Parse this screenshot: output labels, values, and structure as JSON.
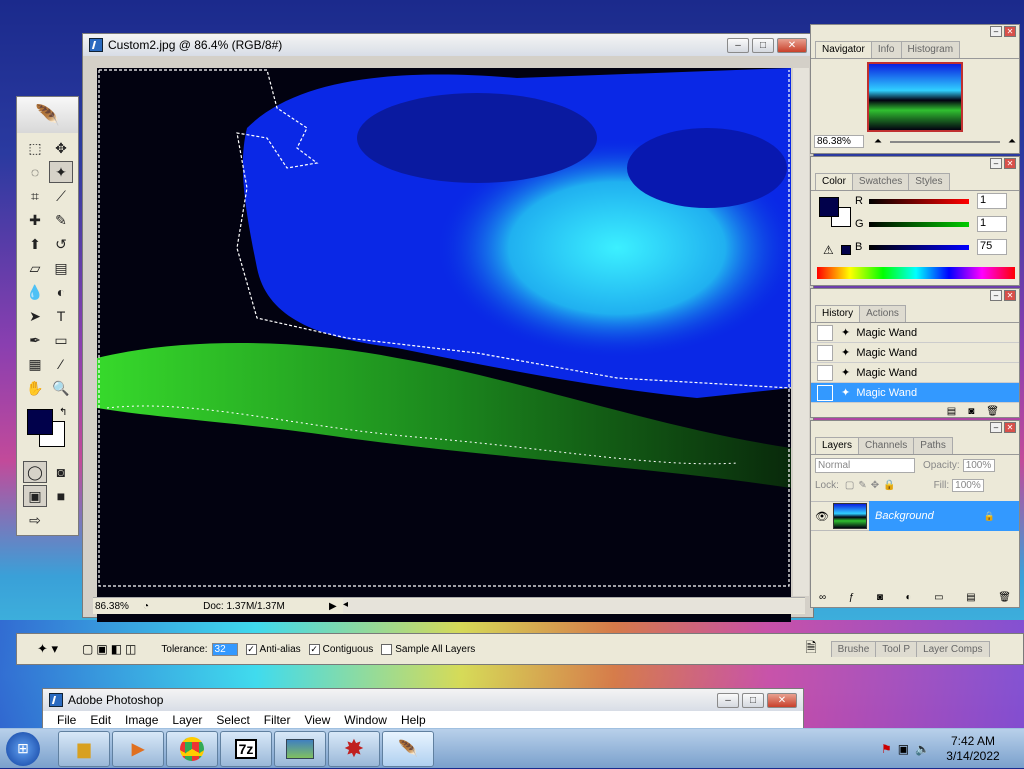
{
  "document": {
    "title": "Custom2.jpg @ 86.4% (RGB/8#)",
    "zoom": "86.38%",
    "doc_size": "Doc: 1.37M/1.37M"
  },
  "navigator": {
    "tabs": [
      "Navigator",
      "Info",
      "Histogram"
    ],
    "zoom": "86.38%"
  },
  "color": {
    "tabs": [
      "Color",
      "Swatches",
      "Styles"
    ],
    "r_label": "R",
    "g_label": "G",
    "b_label": "B",
    "r": "1",
    "g": "1",
    "b": "75",
    "foreground_hex": "#01014b"
  },
  "history": {
    "tabs": [
      "History",
      "Actions"
    ],
    "items": [
      "Magic Wand",
      "Magic Wand",
      "Magic Wand",
      "Magic Wand"
    ]
  },
  "layers": {
    "tabs": [
      "Layers",
      "Channels",
      "Paths"
    ],
    "blend_mode": "Normal",
    "opacity_label": "Opacity:",
    "opacity": "100%",
    "lock_label": "Lock:",
    "fill_label": "Fill:",
    "fill": "100%",
    "layer_name": "Background"
  },
  "options": {
    "tolerance_label": "Tolerance:",
    "tolerance": "32",
    "antialias": "Anti-alias",
    "contiguous": "Contiguous",
    "sample_all": "Sample All Layers",
    "well_tabs": [
      "Brushe",
      "Tool P",
      "Layer Comps"
    ]
  },
  "app_window": {
    "title": "Adobe Photoshop",
    "menu": [
      "File",
      "Edit",
      "Image",
      "Layer",
      "Select",
      "Filter",
      "View",
      "Window",
      "Help"
    ]
  },
  "taskbar": {
    "time": "7:42 AM",
    "date": "3/14/2022",
    "sevenzip": "7z"
  },
  "colors": {
    "highlight": "#3399ff",
    "title_close": "#c8402a"
  }
}
